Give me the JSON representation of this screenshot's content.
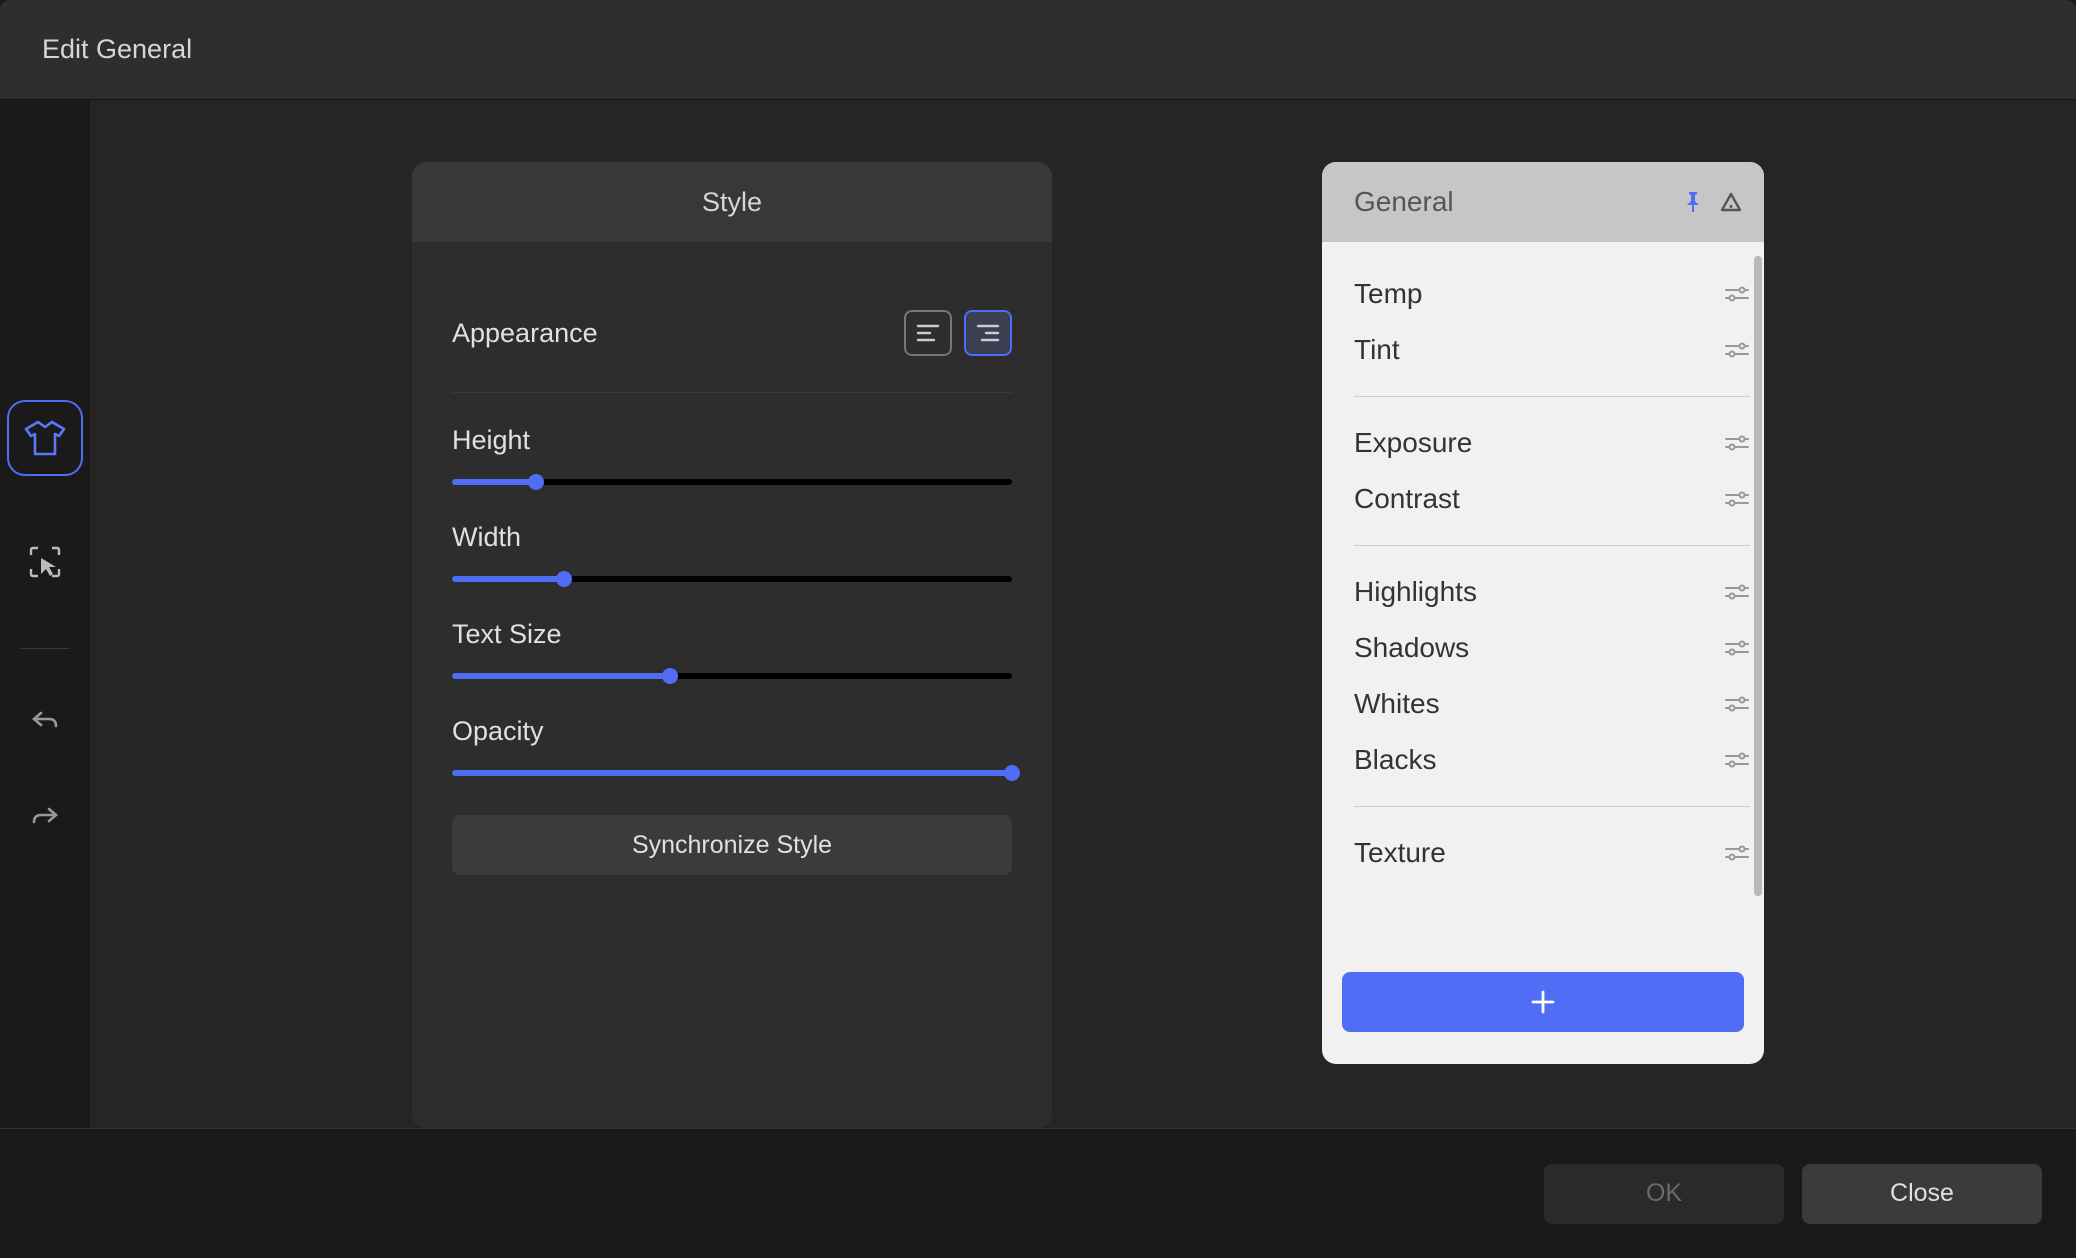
{
  "title": "Edit General",
  "style_panel": {
    "header": "Style",
    "appearance_label": "Appearance",
    "sliders": [
      {
        "label": "Height",
        "value": 15
      },
      {
        "label": "Width",
        "value": 20
      },
      {
        "label": "Text Size",
        "value": 39
      },
      {
        "label": "Opacity",
        "value": 100
      }
    ],
    "sync_label": "Synchronize Style"
  },
  "general_panel": {
    "header": "General",
    "groups": [
      [
        "Temp",
        "Tint"
      ],
      [
        "Exposure",
        "Contrast"
      ],
      [
        "Highlights",
        "Shadows",
        "Whites",
        "Blacks"
      ],
      [
        "Texture"
      ]
    ]
  },
  "footer": {
    "ok": "OK",
    "close": "Close"
  },
  "colors": {
    "accent": "#4f6df5"
  }
}
